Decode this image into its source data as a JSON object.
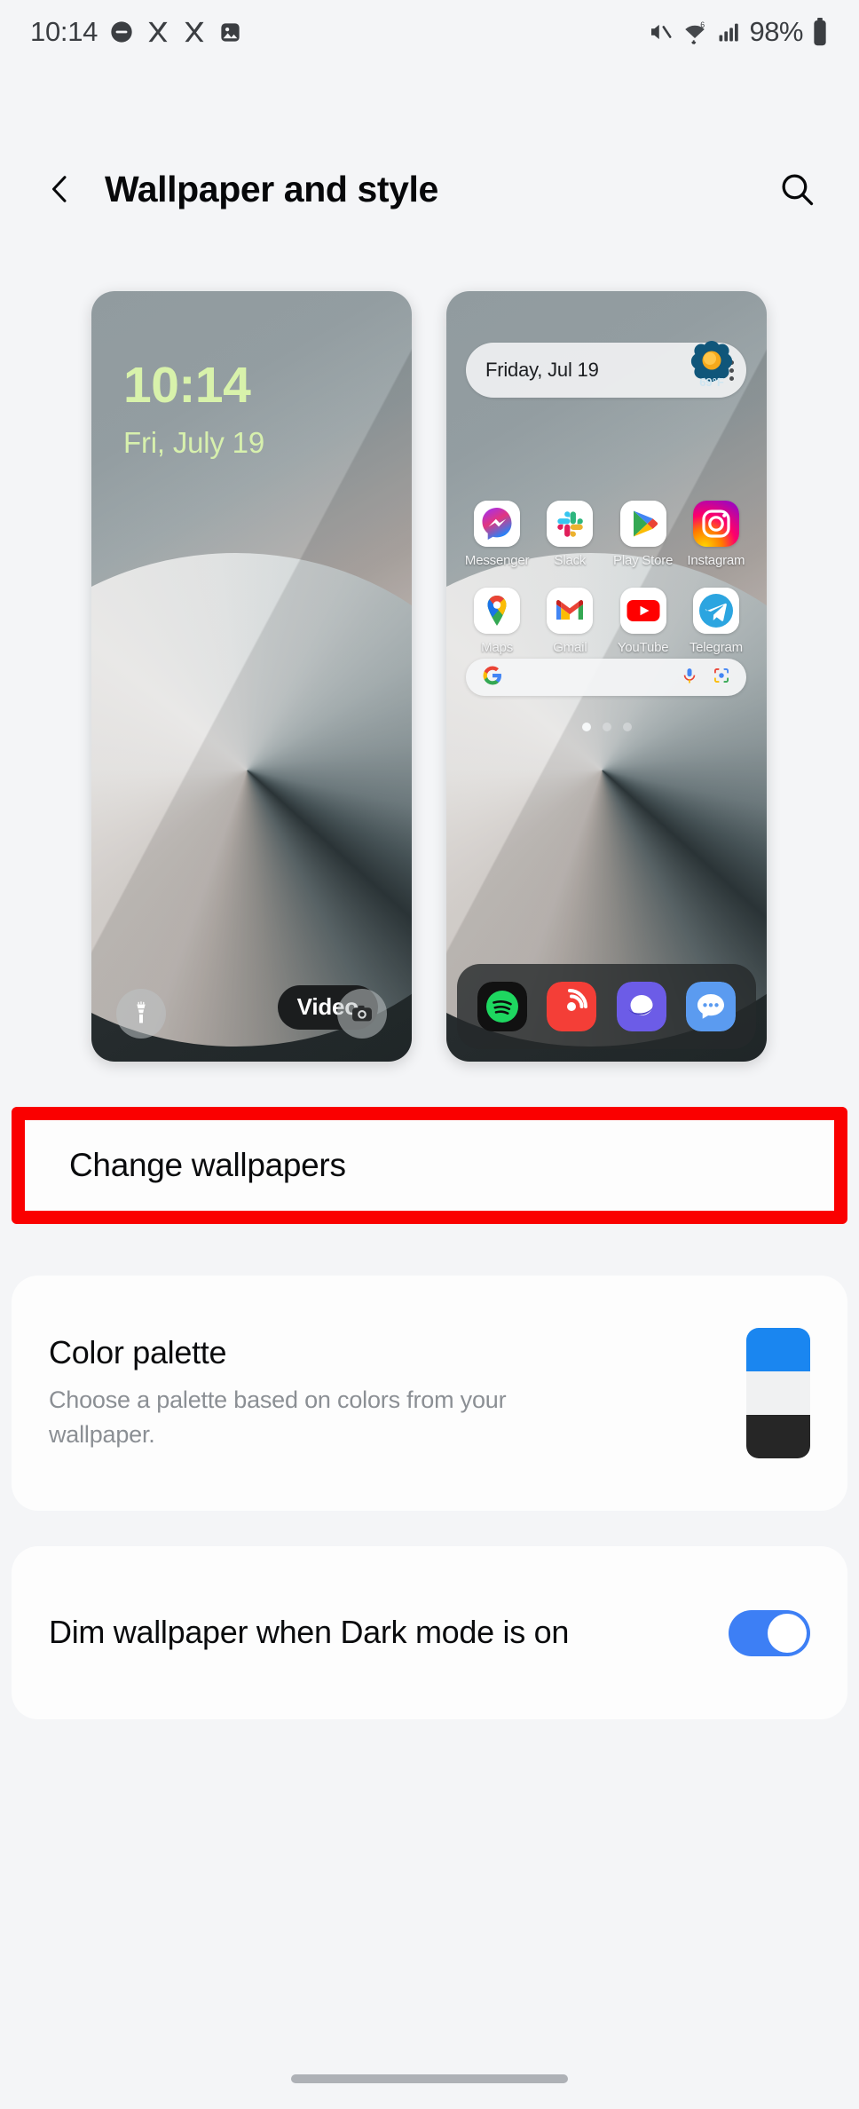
{
  "status_bar": {
    "time": "10:14",
    "battery_percent": "98%",
    "left_icons": [
      "dnd-icon",
      "x-app-icon",
      "x-app-icon",
      "image-icon"
    ],
    "right_icons": [
      "mute-icon",
      "wifi-icon",
      "signal-icon",
      "battery-icon"
    ]
  },
  "header": {
    "back_icon": "chevron-left-icon",
    "title": "Wallpaper and style",
    "search_icon": "search-icon"
  },
  "previews": {
    "lock_screen": {
      "clock": "10:14",
      "date": "Fri, July 19",
      "clock_color": "#d8f2ab",
      "flashlight_icon": "flashlight-icon",
      "camera_icon": "camera-icon",
      "video_label": "Video"
    },
    "home_screen": {
      "widget_date": "Friday, Jul 19",
      "widget_menu_icon": "more-vertical-icon",
      "weather_temp": "69°F",
      "weather_icon": "sun-icon",
      "apps_row1": [
        {
          "name": "Messenger",
          "icon": "messenger-icon"
        },
        {
          "name": "Slack",
          "icon": "slack-icon"
        },
        {
          "name": "Play Store",
          "icon": "play-store-icon"
        },
        {
          "name": "Instagram",
          "icon": "instagram-icon"
        }
      ],
      "apps_row2": [
        {
          "name": "Maps",
          "icon": "maps-icon"
        },
        {
          "name": "Gmail",
          "icon": "gmail-icon"
        },
        {
          "name": "YouTube",
          "icon": "youtube-icon"
        },
        {
          "name": "Telegram",
          "icon": "telegram-icon"
        }
      ],
      "search_bar": {
        "google_icon": "google-g-icon",
        "mic_icon": "microphone-icon",
        "lens_icon": "google-lens-icon"
      },
      "page_dots": 3,
      "active_dot": 1,
      "dock": [
        {
          "name": "Spotify",
          "icon": "spotify-icon"
        },
        {
          "name": "Pocket Casts",
          "icon": "pocket-casts-icon"
        },
        {
          "name": "Samsung Internet",
          "icon": "samsung-internet-icon"
        },
        {
          "name": "Messages",
          "icon": "messages-icon"
        }
      ]
    }
  },
  "settings": {
    "change_wallpapers": {
      "label": "Change wallpapers",
      "highlight_color": "#fa0000"
    },
    "color_palette": {
      "title": "Color palette",
      "subtitle": "Choose a palette based on colors from your wallpaper.",
      "swatch_colors": [
        "#1a86f0",
        "#f0f1f2",
        "#262626"
      ]
    },
    "dim_wallpaper": {
      "label": "Dim wallpaper when Dark mode is on",
      "toggle_state": "on",
      "toggle_color": "#3d7ff5"
    }
  },
  "nav_bar": {
    "gesture_pill": "gesture-handle"
  }
}
